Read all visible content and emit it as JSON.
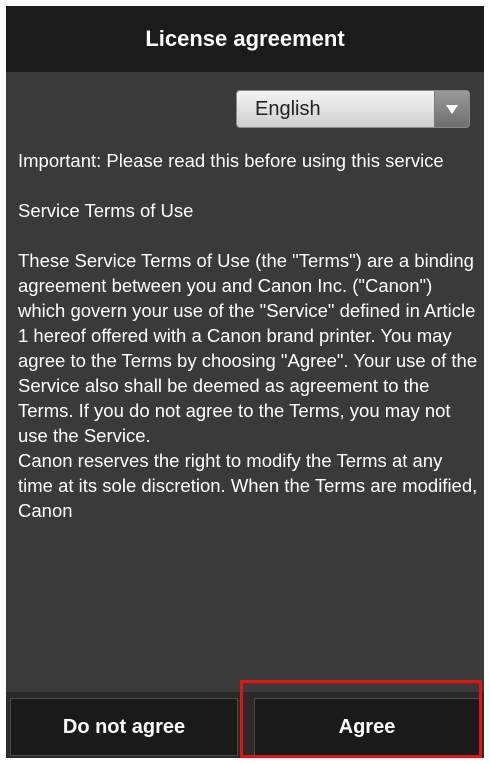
{
  "header": {
    "title": "License agreement"
  },
  "language_select": {
    "selected": "English"
  },
  "agreement": {
    "paragraphs": [
      "Important: Please read this before using this service",
      "Service Terms of Use",
      "These Service Terms of Use (the \"Terms\") are a binding agreement between you and Canon Inc. (\"Canon\") which govern your use of the \"Service\" defined in Article 1 hereof offered with a Canon brand printer. You may agree to the Terms by choosing \"Agree\". Your use of the Service also shall be deemed as agreement to the Terms. If you do not agree to the Terms, you may not use the Service.",
      "Canon reserves the right to modify the Terms at any time at its sole discretion. When the Terms are modified, Canon"
    ]
  },
  "buttons": {
    "disagree_label": "Do not agree",
    "agree_label": "Agree"
  },
  "colors": {
    "title_bar_bg": "#1b1b1b",
    "content_bg": "#3a3a3a",
    "button_bg": "#1a1a1a",
    "highlight": "#e01515"
  }
}
